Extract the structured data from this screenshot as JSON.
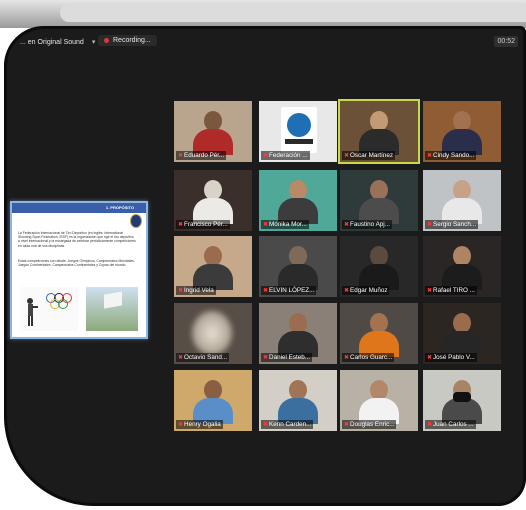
{
  "toolbar": {
    "sound_label": "... en Original Sound",
    "sound_dropdown": "▾",
    "recording_label": "Recording...",
    "clock": "00:52"
  },
  "shared_screen": {
    "header": "1. PROPÓSITO",
    "paragraph1": "La Federación Internacional de Tiro Deportivo (en inglés: International Shooting Sport Federation, ISSF) es la organización que rige el tiro deportivo a nivel internacional y la encargada de celebrar periódicamente competiciones en cada una de sus disciplinas.",
    "paragraph2": "Estas competiciones son desde: Juegos Olímpicos, Campeonatos Mundiales, Juegos Continentales, Campeonatos Continentales y Copas del mundo."
  },
  "participants": [
    {
      "name": "Eduardo Pér...",
      "bg": "#b9a58e",
      "skin": "#7a5840",
      "shirt": "#b02a2a"
    },
    {
      "name": "Federación ...",
      "bg": "#e8e8e8",
      "logo": true
    },
    {
      "name": "Oscar Martínez",
      "bg": "#6a5138",
      "skin": "#c49a76",
      "shirt": "#2b2b2b",
      "active": true
    },
    {
      "name": "Cindy Sando...",
      "bg": "#8f5c34",
      "skin": "#a27250",
      "shirt": "#2b2e4a"
    },
    {
      "name": "Francisco Pér...",
      "bg": "#3a2f2b",
      "skin": "#d9d2c8",
      "shirt": "#eceae6"
    },
    {
      "name": "Mónika Mor...",
      "bg": "#4fa898",
      "skin": "#b88a68",
      "shirt": "#3c3c3c"
    },
    {
      "name": "Faustino Apj...",
      "bg": "#2f3a3a",
      "skin": "#9b7058",
      "shirt": "#4c4c4c"
    },
    {
      "name": "Sergio Sanch...",
      "bg": "#bfc3c6",
      "skin": "#c7a287",
      "shirt": "#e8e8e8"
    },
    {
      "name": "Ingrid Vela",
      "bg": "#c6a98a",
      "skin": "#9a6b4e",
      "shirt": "#3b3b3b"
    },
    {
      "name": "ELVIN LÓPEZ...",
      "bg": "#4a4a4a",
      "skin": "#7f6a5a",
      "shirt": "#2a2a2a"
    },
    {
      "name": "Edgar Muñoz",
      "bg": "#282828",
      "skin": "#5a4a40",
      "shirt": "#1a1a1a"
    },
    {
      "name": "Rafael TIRO ...",
      "bg": "#2a2626",
      "skin": "#b08462",
      "shirt": "#1c1c1c"
    },
    {
      "name": "Octavio Sand...",
      "bg": "#574f47",
      "blur": true
    },
    {
      "name": "Daniel Esteb...",
      "bg": "#8a8078",
      "skin": "#9a6d50",
      "shirt": "#2e2e2e"
    },
    {
      "name": "Carlos Guarc...",
      "bg": "#4f4a45",
      "skin": "#a37350",
      "shirt": "#e0761c"
    },
    {
      "name": "José Pablo V...",
      "bg": "#2b2622",
      "skin": "#9a6b4c",
      "shirt": "#262626"
    },
    {
      "name": "Henry Ogalia",
      "bg": "#cfa96b",
      "skin": "#8a5e40",
      "shirt": "#5a8ec8"
    },
    {
      "name": "Kenn Carden...",
      "bg": "#d3cfc6",
      "skin": "#a07454",
      "shirt": "#3b6fa0"
    },
    {
      "name": "Douglas Enric...",
      "bg": "#b8b2a6",
      "skin": "#b3886a",
      "shirt": "#f2f2f2"
    },
    {
      "name": "Juan Carlos ...",
      "bg": "#c9c9c4",
      "skin": "#a88466",
      "shirt": "#4a4a4a",
      "mask": true
    }
  ]
}
